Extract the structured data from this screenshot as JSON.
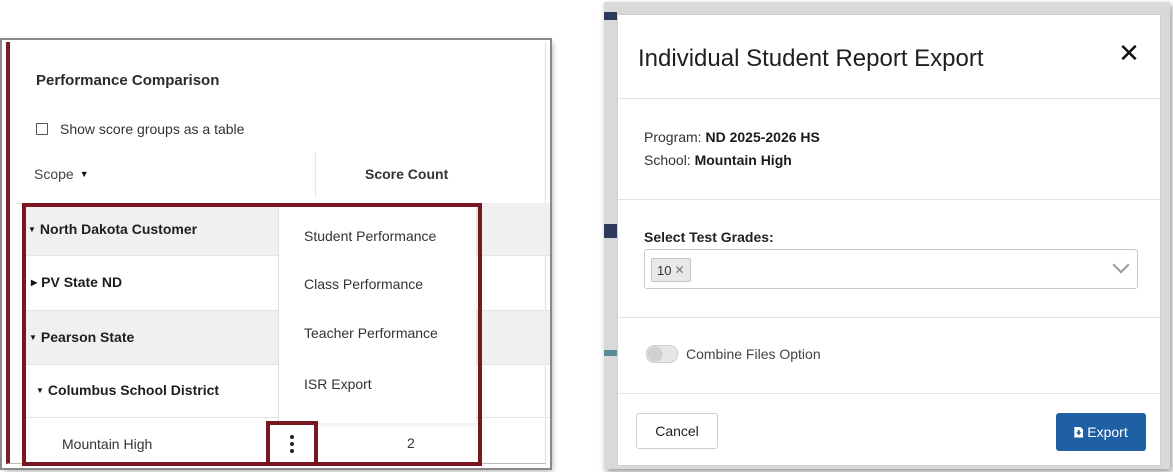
{
  "performance": {
    "title": "Performance Comparison",
    "show_table_label": "Show score groups as a table",
    "scope_header": "Scope",
    "count_header": "Score Count",
    "tree": [
      {
        "label": "North Dakota Customer"
      },
      {
        "label": "PV State ND"
      },
      {
        "label": "Pearson State"
      },
      {
        "label": "Columbus School District"
      },
      {
        "label": "Mountain High",
        "score_count": "2"
      }
    ],
    "menu": [
      "Student Performance",
      "Class Performance",
      "Teacher Performance",
      "ISR Export"
    ]
  },
  "modal": {
    "title": "Individual Student Report Export",
    "program_label": "Program:",
    "program_value": "ND 2025-2026 HS",
    "school_label": "School:",
    "school_value": "Mountain High",
    "grades_label": "Select Test Grades:",
    "selected_grade": "10",
    "combine_label": "Combine Files Option",
    "combine_enabled": false,
    "cancel_label": "Cancel",
    "export_label": "Export",
    "accent_color": "#1f5fa3"
  },
  "highlight_color": "#7a1522"
}
